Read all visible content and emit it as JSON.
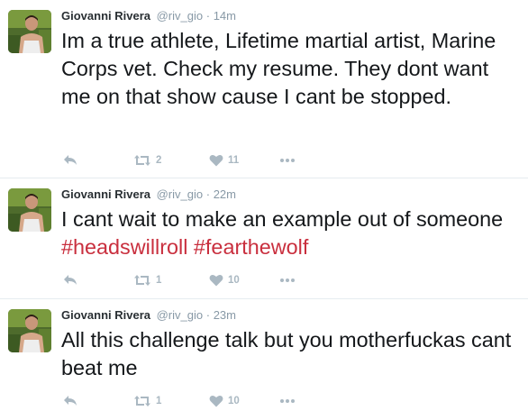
{
  "tweets": [
    {
      "fullname": "Giovanni Rivera",
      "handle": "@riv_gio",
      "separator": "·",
      "time": "14m",
      "text_parts": [
        "Im a true athlete, Lifetime martial artist, Marine Corps vet. Check my resume. They dont want me on that show cause I cant be stopped."
      ],
      "retweets": "2",
      "likes": "11"
    },
    {
      "fullname": "Giovanni Rivera",
      "handle": "@riv_gio",
      "separator": "·",
      "time": "22m",
      "text_parts": [
        "I cant wait to make an example out of someone ",
        "#headswillroll",
        " ",
        "#fearthewolf"
      ],
      "retweets": "1",
      "likes": "10"
    },
    {
      "fullname": "Giovanni Rivera",
      "handle": "@riv_gio",
      "separator": "·",
      "time": "23m",
      "text_parts": [
        "All this challenge talk but you motherfuckas cant beat me"
      ],
      "retweets": "1",
      "likes": "10"
    }
  ],
  "colors": {
    "hashtag": "#c92f3e",
    "meta": "#8899a6",
    "action_icon": "#aab8c2",
    "divider": "#e6ecf0"
  },
  "icons": [
    "reply-icon",
    "retweet-icon",
    "heart-icon",
    "more-icon"
  ]
}
